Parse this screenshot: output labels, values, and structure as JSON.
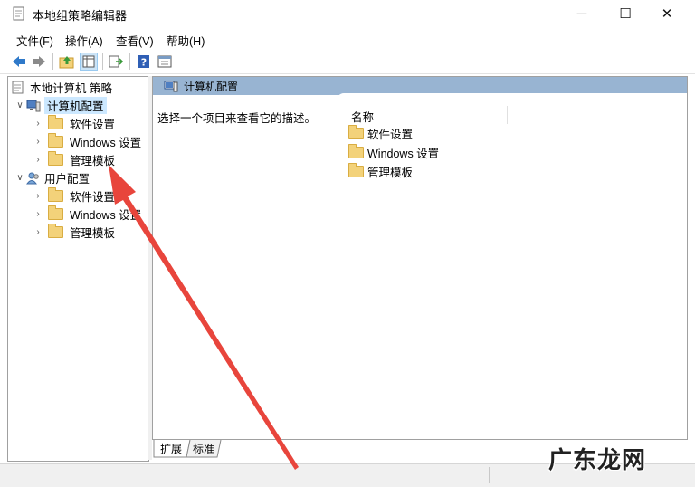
{
  "window": {
    "title": "本地组策略编辑器",
    "minimize_glyph": "─",
    "maximize_glyph": "☐",
    "close_glyph": "✕"
  },
  "menubar": {
    "items": [
      "文件(F)",
      "操作(A)",
      "查看(V)",
      "帮助(H)"
    ]
  },
  "toolbar": {
    "icons": [
      "back-arrow-icon",
      "forward-arrow-icon",
      "up-folder-icon",
      "show-hide-tree-icon",
      "export-list-icon",
      "help-icon",
      "properties-icon"
    ]
  },
  "tree": {
    "root_label": "本地计算机 策略",
    "computer": {
      "label": "计算机配置",
      "children": [
        "软件设置",
        "Windows 设置",
        "管理模板"
      ]
    },
    "user": {
      "label": "用户配置",
      "children": [
        "软件设置",
        "Windows 设置",
        "管理模板"
      ]
    }
  },
  "right_pane": {
    "header": "计算机配置",
    "description": "选择一个项目来查看它的描述。",
    "column_name": "名称",
    "items": [
      "软件设置",
      "Windows 设置",
      "管理模板"
    ]
  },
  "tabs": [
    "扩展",
    "标准"
  ],
  "watermark": "广东龙网",
  "colors": {
    "header_blue": "#98b4d2",
    "tree_selected": "#cce8ff",
    "folder_yellow": "#f3d27a",
    "annotation_red": "#e8453c"
  }
}
